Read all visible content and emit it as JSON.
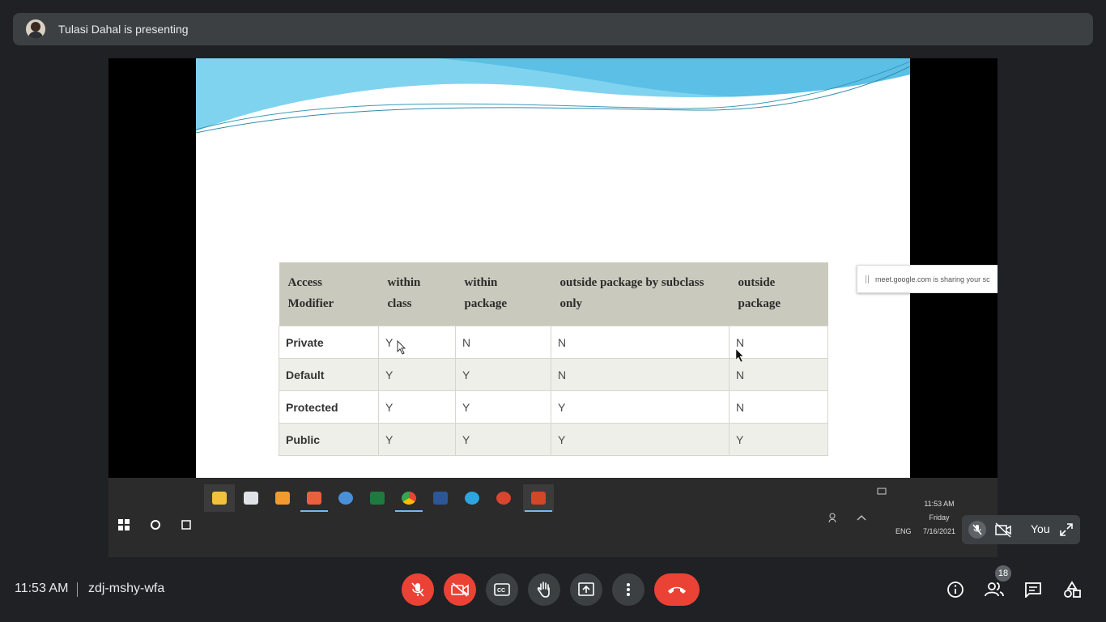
{
  "header": {
    "presenter_text": "Tulasi Dahal is presenting"
  },
  "slide": {
    "table": {
      "headers": [
        [
          "Access",
          "Modifier"
        ],
        [
          "within",
          "class"
        ],
        [
          "within",
          "package"
        ],
        [
          "outside package by subclass",
          "only"
        ],
        [
          "outside",
          "package"
        ]
      ],
      "rows": [
        [
          "Private",
          "Y",
          "N",
          "N",
          "N"
        ],
        [
          "Default",
          "Y",
          "Y",
          "N",
          "N"
        ],
        [
          "Protected",
          "Y",
          "Y",
          "Y",
          "N"
        ],
        [
          "Public",
          "Y",
          "Y",
          "Y",
          "Y"
        ]
      ]
    },
    "share_notice": "meet.google.com is sharing your sc"
  },
  "taskbar": {
    "tray_lang": "ENG",
    "clock_time": "11:53 AM",
    "clock_day": "Friday",
    "clock_date": "7/16/2021"
  },
  "self_tile": {
    "label": "You"
  },
  "footer": {
    "time": "11:53 AM",
    "meeting_code": "zdj-mshy-wfa",
    "participants_count": "18"
  },
  "colors": {
    "danger": "#ea4335",
    "bar_bg": "#202124",
    "control_bg": "#3c4043"
  }
}
